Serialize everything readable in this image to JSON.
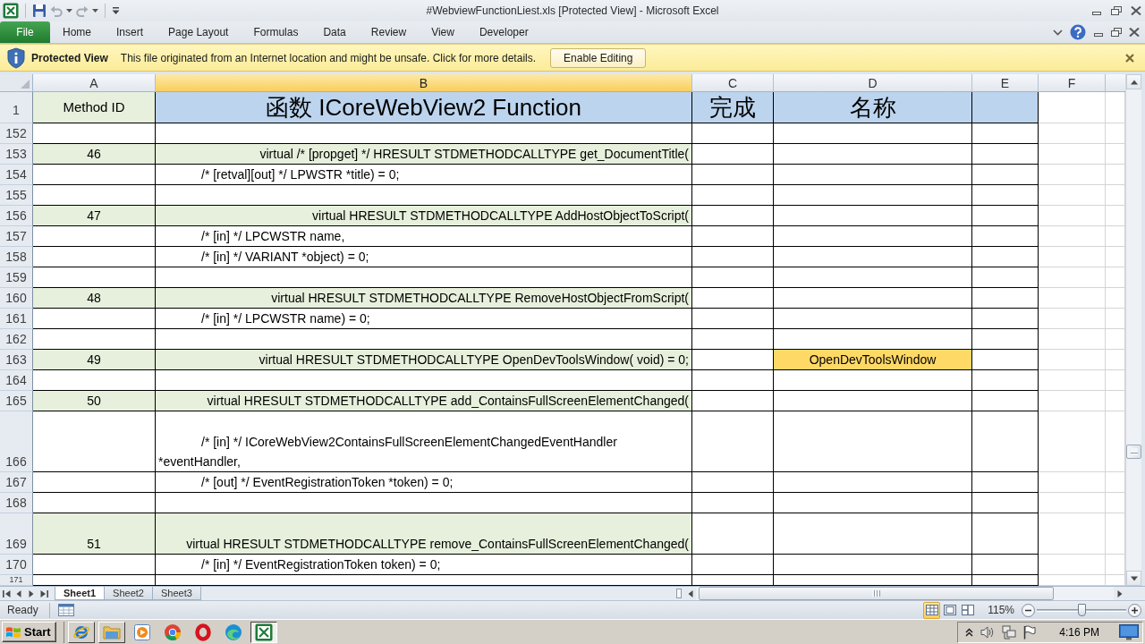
{
  "title_bar": {
    "title": "#WebviewFunctionLiest.xls [Protected View] - Microsoft Excel",
    "quick_access": [
      {
        "kind": "save",
        "disabled": false
      },
      {
        "kind": "undo",
        "disabled": true
      },
      {
        "kind": "redo",
        "disabled": true
      },
      {
        "kind": "customize",
        "disabled": false
      }
    ]
  },
  "ribbon": {
    "tabs": [
      {
        "label": "File",
        "kind": "file"
      },
      {
        "label": "Home",
        "kind": "tab"
      },
      {
        "label": "Insert",
        "kind": "tab"
      },
      {
        "label": "Page Layout",
        "kind": "tab"
      },
      {
        "label": "Formulas",
        "kind": "tab"
      },
      {
        "label": "Data",
        "kind": "tab"
      },
      {
        "label": "Review",
        "kind": "tab"
      },
      {
        "label": "View",
        "kind": "tab"
      },
      {
        "label": "Developer",
        "kind": "tab"
      }
    ]
  },
  "message_bar": {
    "title": "Protected View",
    "message": "This file originated from an Internet location and might be unsafe. Click for more details.",
    "button": "Enable Editing"
  },
  "sheet": {
    "columns": [
      {
        "label": "A",
        "selected": false
      },
      {
        "label": "B",
        "selected": true
      },
      {
        "label": "C",
        "selected": false
      },
      {
        "label": "D",
        "selected": false
      },
      {
        "label": "E",
        "selected": false
      },
      {
        "label": "F",
        "selected": false
      }
    ],
    "header": {
      "number": "1",
      "method_id": "Method ID",
      "function": "函数 ICoreWebView2 Function",
      "done": "完成",
      "name": "名称"
    },
    "rows": [
      {
        "number": "152",
        "kind": "blank",
        "wrap_text": false,
        "highlighted": false
      },
      {
        "number": "153",
        "kind": "method",
        "wrap_text": false,
        "highlighted": false,
        "method_id": "46",
        "code": "virtual /* [propget] */ HRESULT STDMETHODCALLTYPE get_DocumentTitle("
      },
      {
        "number": "154",
        "kind": "param",
        "wrap_text": false,
        "highlighted": false,
        "code": "/* [retval][out] */ LPWSTR *title) = 0;"
      },
      {
        "number": "155",
        "kind": "blank",
        "wrap_text": false,
        "highlighted": false
      },
      {
        "number": "156",
        "kind": "method",
        "wrap_text": false,
        "highlighted": false,
        "method_id": "47",
        "code": "virtual HRESULT STDMETHODCALLTYPE AddHostObjectToScript("
      },
      {
        "number": "157",
        "kind": "param",
        "wrap_text": false,
        "highlighted": false,
        "code": "/* [in] */ LPCWSTR name,"
      },
      {
        "number": "158",
        "kind": "param",
        "wrap_text": false,
        "highlighted": false,
        "code": "/* [in] */ VARIANT *object) = 0;"
      },
      {
        "number": "159",
        "kind": "blank",
        "wrap_text": false,
        "highlighted": false
      },
      {
        "number": "160",
        "kind": "method",
        "wrap_text": false,
        "highlighted": false,
        "method_id": "48",
        "code": "virtual HRESULT STDMETHODCALLTYPE RemoveHostObjectFromScript("
      },
      {
        "number": "161",
        "kind": "param",
        "wrap_text": false,
        "highlighted": false,
        "code": "/* [in] */ LPCWSTR name) = 0;"
      },
      {
        "number": "162",
        "kind": "blank",
        "wrap_text": false,
        "highlighted": false
      },
      {
        "number": "163",
        "kind": "method",
        "wrap_text": false,
        "highlighted": true,
        "method_id": "49",
        "code": "virtual HRESULT STDMETHODCALLTYPE OpenDevToolsWindow( void) = 0;",
        "name": "OpenDevToolsWindow"
      },
      {
        "number": "164",
        "kind": "blank",
        "wrap_text": false,
        "highlighted": false
      },
      {
        "number": "165",
        "kind": "method",
        "wrap_text": false,
        "highlighted": false,
        "method_id": "50",
        "code": "virtual HRESULT STDMETHODCALLTYPE add_ContainsFullScreenElementChanged("
      },
      {
        "number": "166",
        "kind": "param",
        "wrap_text": true,
        "highlighted": false,
        "code": "/* [in] */ ICoreWebView2ContainsFullScreenElementChangedEventHandler *eventHandler,"
      },
      {
        "number": "167",
        "kind": "param",
        "wrap_text": false,
        "highlighted": false,
        "code": "/* [out] */ EventRegistrationToken *token) = 0;"
      },
      {
        "number": "168",
        "kind": "blank",
        "wrap_text": false,
        "highlighted": false
      },
      {
        "number": "169",
        "kind": "method",
        "wrap_text": true,
        "highlighted": false,
        "method_id": "51",
        "code": "virtual HRESULT STDMETHODCALLTYPE remove_ContainsFullScreenElementChanged("
      },
      {
        "number": "170",
        "kind": "param",
        "wrap_text": false,
        "highlighted": false,
        "code": "/* [in] */ EventRegistrationToken token) = 0;"
      },
      {
        "number": "171",
        "kind": "blank",
        "wrap_text": false,
        "highlighted": false
      }
    ]
  },
  "sheet_tabs": [
    {
      "label": "Sheet1",
      "selected": true
    },
    {
      "label": "Sheet2",
      "selected": false
    },
    {
      "label": "Sheet3",
      "selected": false
    }
  ],
  "status_bar": {
    "status": "Ready",
    "views": [
      {
        "kind": "normal",
        "selected": true
      },
      {
        "kind": "page_layout",
        "selected": false
      },
      {
        "kind": "page_break",
        "selected": false
      }
    ],
    "zoom": {
      "label": "115%",
      "level": 0.51
    }
  },
  "taskbar": {
    "start": "Start",
    "apps": [
      {
        "kind": "ie",
        "running": true,
        "selected": false
      },
      {
        "kind": "explorer",
        "running": true,
        "selected": false
      },
      {
        "kind": "media",
        "running": false,
        "selected": false
      },
      {
        "kind": "chrome",
        "running": false,
        "selected": false
      },
      {
        "kind": "opera",
        "running": false,
        "selected": false
      },
      {
        "kind": "edge",
        "running": false,
        "selected": false
      },
      {
        "kind": "excel",
        "running": true,
        "selected": true
      }
    ],
    "clock": "4:16 PM"
  }
}
